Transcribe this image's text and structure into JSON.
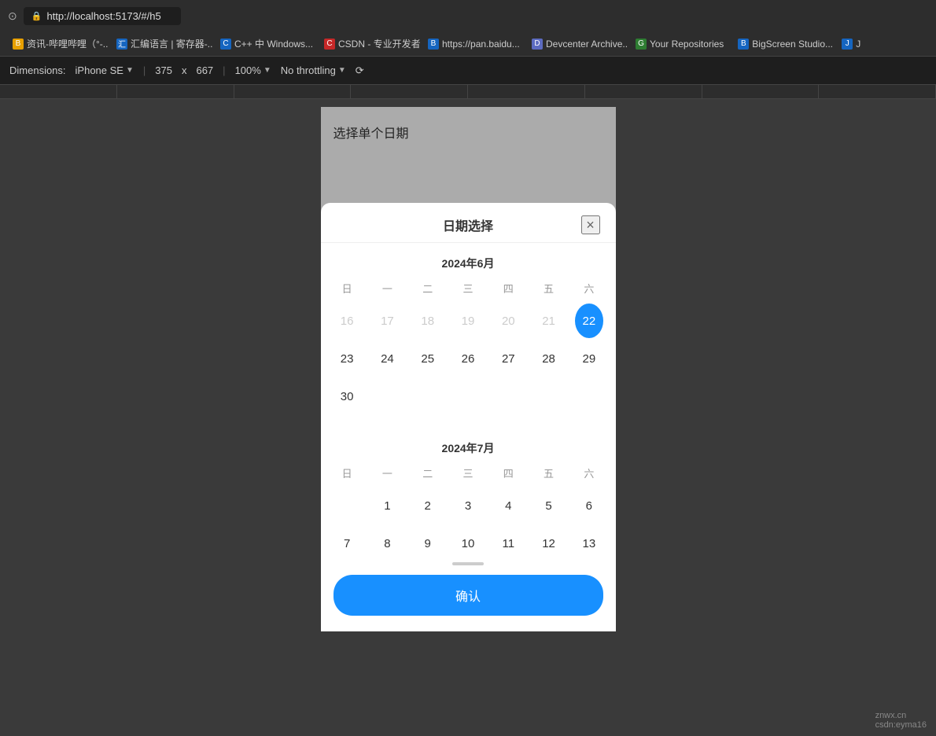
{
  "browser": {
    "url": "http://localhost:5173/#/h5",
    "lock_icon": "🔒"
  },
  "bookmarks": [
    {
      "id": "b1",
      "label": "资讯-哔哩哔哩（°-...",
      "favicon_class": "favicon-orange",
      "favicon_text": "B"
    },
    {
      "id": "b2",
      "label": "汇编语言 | 寄存器-...",
      "favicon_class": "favicon-blue",
      "favicon_text": "汇"
    },
    {
      "id": "b3",
      "label": "C++ 中 Windows...",
      "favicon_class": "favicon-blue",
      "favicon_text": "C"
    },
    {
      "id": "b4",
      "label": "CSDN - 专业开发者...",
      "favicon_class": "favicon-red",
      "favicon_text": "C"
    },
    {
      "id": "b5",
      "label": "https://pan.baidu...",
      "favicon_class": "favicon-blue",
      "favicon_text": "B"
    },
    {
      "id": "b6",
      "label": "Devcenter Archive...",
      "favicon_class": "favicon-globe",
      "favicon_text": "D"
    },
    {
      "id": "b7",
      "label": "Your Repositories",
      "favicon_class": "favicon-green",
      "favicon_text": "G"
    },
    {
      "id": "b8",
      "label": "BigScreen Studio...",
      "favicon_class": "favicon-blue",
      "favicon_text": "B"
    },
    {
      "id": "b9",
      "label": "J",
      "favicon_class": "favicon-blue",
      "favicon_text": "J"
    }
  ],
  "devtools": {
    "dimensions_label": "Dimensions:",
    "device_name": "iPhone SE",
    "width": "375",
    "x_label": "x",
    "height": "667",
    "zoom_label": "100%",
    "throttle_label": "No throttling",
    "rotate_icon": "⟳"
  },
  "app": {
    "page_title": "选择单个日期"
  },
  "calendar_dialog": {
    "title": "日期选择",
    "close_label": "×",
    "weekdays": [
      "日",
      "一",
      "二",
      "三",
      "四",
      "五",
      "六"
    ],
    "june": {
      "month_label": "2024年6月",
      "weeks": [
        [
          {
            "day": "16",
            "type": "prev-month"
          },
          {
            "day": "17",
            "type": "prev-month"
          },
          {
            "day": "18",
            "type": "prev-month"
          },
          {
            "day": "19",
            "type": "prev-month"
          },
          {
            "day": "20",
            "type": "prev-month"
          },
          {
            "day": "21",
            "type": "prev-month"
          },
          {
            "day": "22",
            "type": "selected"
          }
        ],
        [
          {
            "day": "23",
            "type": ""
          },
          {
            "day": "24",
            "type": ""
          },
          {
            "day": "25",
            "type": ""
          },
          {
            "day": "26",
            "type": ""
          },
          {
            "day": "27",
            "type": ""
          },
          {
            "day": "28",
            "type": ""
          },
          {
            "day": "29",
            "type": ""
          }
        ],
        [
          {
            "day": "30",
            "type": ""
          },
          {
            "day": "",
            "type": "empty"
          },
          {
            "day": "",
            "type": "empty"
          },
          {
            "day": "",
            "type": "empty"
          },
          {
            "day": "",
            "type": "empty"
          },
          {
            "day": "",
            "type": "empty"
          },
          {
            "day": "",
            "type": "empty"
          }
        ]
      ]
    },
    "july": {
      "month_label": "2024年7月",
      "weeks": [
        [
          {
            "day": "",
            "type": "empty"
          },
          {
            "day": "1",
            "type": ""
          },
          {
            "day": "2",
            "type": ""
          },
          {
            "day": "3",
            "type": ""
          },
          {
            "day": "4",
            "type": ""
          },
          {
            "day": "5",
            "type": ""
          },
          {
            "day": "6",
            "type": ""
          }
        ],
        [
          {
            "day": "7",
            "type": ""
          },
          {
            "day": "8",
            "type": ""
          },
          {
            "day": "9",
            "type": ""
          },
          {
            "day": "10",
            "type": ""
          },
          {
            "day": "11",
            "type": ""
          },
          {
            "day": "12",
            "type": ""
          },
          {
            "day": "13",
            "type": ""
          }
        ]
      ]
    },
    "confirm_label": "确认"
  },
  "watermark": {
    "site": "znwx.cn",
    "user": "csdn:eyma16"
  }
}
